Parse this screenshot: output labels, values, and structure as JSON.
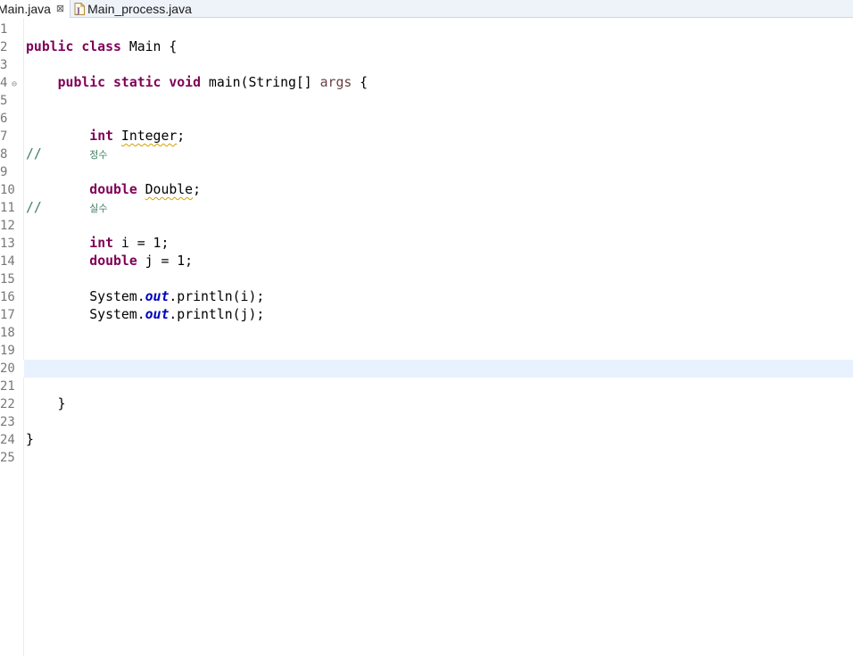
{
  "tabs": [
    {
      "label": "Main.java",
      "active": true,
      "close_glyph": "⊠"
    },
    {
      "label": "Main_process.java",
      "active": false
    }
  ],
  "colors": {
    "keyword": "#7f0055",
    "field": "#0000c0",
    "parameter": "#6a3e3e",
    "comment": "#3f7f5f",
    "current_line": "#e8f2fe",
    "line_number": "#787878"
  },
  "editor": {
    "current_line": 20,
    "lines": [
      {
        "n": "1"
      },
      {
        "n": "2",
        "t": [
          [
            "kw",
            "public class "
          ],
          [
            "",
            "Main {"
          ]
        ]
      },
      {
        "n": "3"
      },
      {
        "n": "4",
        "fold": "⊖",
        "t": [
          [
            "",
            "    "
          ],
          [
            "kw",
            "public static void "
          ],
          [
            "",
            "main(String[] "
          ],
          [
            "param",
            "args"
          ],
          [
            "",
            " {"
          ]
        ]
      },
      {
        "n": "5"
      },
      {
        "n": "6"
      },
      {
        "n": "7",
        "t": [
          [
            "",
            "        "
          ],
          [
            "kw",
            "int "
          ],
          [
            "warn",
            "Integer"
          ],
          [
            "",
            ";"
          ]
        ]
      },
      {
        "n": "8",
        "t": [
          [
            "cm",
            "//      "
          ],
          [
            "ko",
            "정수"
          ]
        ]
      },
      {
        "n": "9"
      },
      {
        "n": "10",
        "t": [
          [
            "",
            "        "
          ],
          [
            "kw",
            "double "
          ],
          [
            "warn",
            "Double"
          ],
          [
            "",
            ";"
          ]
        ]
      },
      {
        "n": "11",
        "t": [
          [
            "cm",
            "//      "
          ],
          [
            "ko",
            "실수"
          ]
        ]
      },
      {
        "n": "12"
      },
      {
        "n": "13",
        "t": [
          [
            "",
            "        "
          ],
          [
            "kw",
            "int "
          ],
          [
            "",
            "i = 1;"
          ]
        ]
      },
      {
        "n": "14",
        "t": [
          [
            "",
            "        "
          ],
          [
            "kw",
            "double "
          ],
          [
            "",
            "j = 1;"
          ]
        ]
      },
      {
        "n": "15"
      },
      {
        "n": "16",
        "t": [
          [
            "",
            "        System."
          ],
          [
            "fld",
            "out"
          ],
          [
            "",
            ".println(i);"
          ]
        ]
      },
      {
        "n": "17",
        "t": [
          [
            "",
            "        System."
          ],
          [
            "fld",
            "out"
          ],
          [
            "",
            ".println(j);"
          ]
        ]
      },
      {
        "n": "18"
      },
      {
        "n": "19"
      },
      {
        "n": "20"
      },
      {
        "n": "21"
      },
      {
        "n": "22",
        "t": [
          [
            "",
            "    }"
          ]
        ]
      },
      {
        "n": "23"
      },
      {
        "n": "24",
        "t": [
          [
            "",
            "}"
          ]
        ]
      },
      {
        "n": "25"
      }
    ]
  }
}
